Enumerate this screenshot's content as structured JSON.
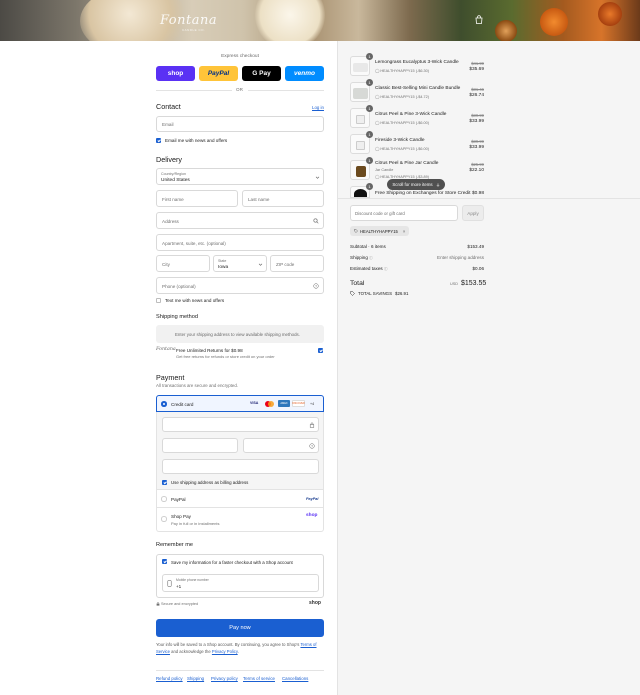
{
  "header": {
    "logo": "Fontana",
    "logo_sub": "CANDLE CO."
  },
  "express": {
    "title": "Express checkout",
    "buttons": [
      {
        "label": "shop",
        "bg": "#5a31f4",
        "color": "#ffffff"
      },
      {
        "label": "PayPal",
        "bg": "#ffc439",
        "color": "#003087"
      },
      {
        "label": "G Pay",
        "bg": "#000000",
        "color": "#ffffff"
      },
      {
        "label": "venmo",
        "bg": "#008cff",
        "color": "#ffffff"
      }
    ],
    "or": "OR"
  },
  "contact": {
    "title": "Contact",
    "login": "Log in",
    "email_placeholder": "Email",
    "news_label": "Email me with news and offers"
  },
  "delivery": {
    "title": "Delivery",
    "country_label": "Country/Region",
    "country_value": "United States",
    "first_name": "First name",
    "last_name": "Last name",
    "address": "Address",
    "apartment": "Apartment, suite, etc. (optional)",
    "city": "City",
    "state_label": "State",
    "state_value": "Iowa",
    "zip": "ZIP code",
    "phone": "Phone (optional)",
    "text_label": "Text me with news and offers"
  },
  "shipping": {
    "title": "Shipping method",
    "notice": "Enter your shipping address to view available shipping methods.",
    "returns_title": "Free Unlimited Returns for $0.98",
    "returns_sub": "Get free returns for refunds or store credit on your order",
    "returns_logo": "Fontana"
  },
  "payment": {
    "title": "Payment",
    "subtitle": "All transactions are secure and encrypted.",
    "credit_card": "Credit card",
    "cards": [
      "VISA",
      "MC",
      "AMEX",
      "DISCOVER",
      "+4"
    ],
    "billing_label": "Use shipping address as billing address",
    "paypal": "PayPal",
    "paypal_logo": "PayPal",
    "shoppay": "Shop Pay",
    "shoppay_sub": "Pay in full or in installments",
    "shoppay_logo": "shop"
  },
  "remember": {
    "title": "Remember me",
    "save_label": "Save my information for a faster checkout with a Shop account",
    "mobile_label": "Mobile phone number",
    "mobile_value": "+1",
    "secure": "Secure and encrypted",
    "shop_logo": "shop"
  },
  "pay_button": "Pay now",
  "legal": {
    "text1": "Your info will be saved to a Shop account. By continuing, you agree to Shop's",
    "terms": "Terms of Service",
    "text2": "and acknowledge the",
    "privacy": "Privacy Policy",
    "dot": "."
  },
  "footer_links": [
    "Refund policy",
    "Shipping",
    "Privacy policy",
    "Terms of service",
    "Cancellations"
  ],
  "items": [
    {
      "qty": "1",
      "name": "Lemongrass Eucalyptus 3-Wick Candle",
      "variant": "",
      "discount": "HEALTHYHAPPY15 (-$6.30)",
      "old": "$41.99",
      "price": "$35.69"
    },
    {
      "qty": "1",
      "name": "Classic Best-Selling Mini Candle Bundle",
      "variant": "",
      "discount": "HEALTHYHAPPY15 (-$4.72)",
      "old": "$31.46",
      "price": "$26.74"
    },
    {
      "qty": "1",
      "name": "Citrus Peel & Pine 3-Wick Candle",
      "variant": "",
      "discount": "HEALTHYHAPPY15 (-$6.00)",
      "old": "$39.99",
      "price": "$33.99"
    },
    {
      "qty": "1",
      "name": "Fireside 3-Wick Candle",
      "variant": "",
      "discount": "HEALTHYHAPPY15 (-$6.00)",
      "old": "$39.99",
      "price": "$33.99"
    },
    {
      "qty": "1",
      "name": "Citrus Peel & Pine Jar Candle",
      "variant": "Jar Candle",
      "discount": "HEALTHYHAPPY15 (-$3.89)",
      "old": "$25.99",
      "price": "$22.10"
    },
    {
      "qty": "1",
      "name": "Free Shipping on Exchanges for Store Credit",
      "variant": "",
      "discount": "",
      "old": "",
      "price": "$0.98"
    }
  ],
  "scroll_pill": "Scroll for more items",
  "discount": {
    "placeholder": "Discount code or gift card",
    "apply": "Apply",
    "tag": "HEALTHYHAPPY15"
  },
  "totals": {
    "subtotal_label": "Subtotal · 6 items",
    "subtotal_value": "$153.49",
    "shipping_label": "Shipping",
    "shipping_value": "Enter shipping address",
    "taxes_label": "Estimated taxes",
    "taxes_value": "$0.06",
    "total_label": "Total",
    "currency": "USD",
    "total_value": "$153.55",
    "savings_label": "TOTAL SAVINGS",
    "savings_value": "$26.91"
  }
}
